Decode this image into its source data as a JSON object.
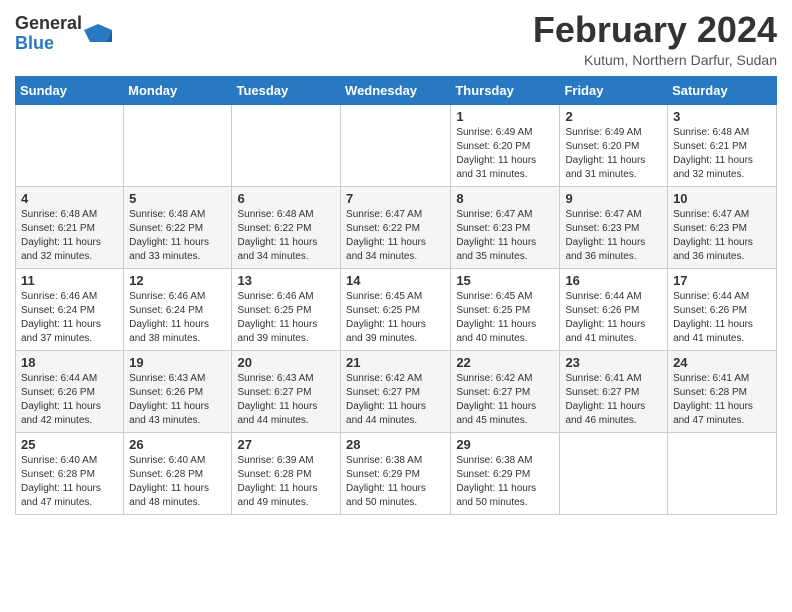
{
  "logo": {
    "general": "General",
    "blue": "Blue"
  },
  "title": "February 2024",
  "subtitle": "Kutum, Northern Darfur, Sudan",
  "days_header": [
    "Sunday",
    "Monday",
    "Tuesday",
    "Wednesday",
    "Thursday",
    "Friday",
    "Saturday"
  ],
  "weeks": [
    [
      {
        "day": "",
        "info": ""
      },
      {
        "day": "",
        "info": ""
      },
      {
        "day": "",
        "info": ""
      },
      {
        "day": "",
        "info": ""
      },
      {
        "day": "1",
        "info": "Sunrise: 6:49 AM\nSunset: 6:20 PM\nDaylight: 11 hours\nand 31 minutes."
      },
      {
        "day": "2",
        "info": "Sunrise: 6:49 AM\nSunset: 6:20 PM\nDaylight: 11 hours\nand 31 minutes."
      },
      {
        "day": "3",
        "info": "Sunrise: 6:48 AM\nSunset: 6:21 PM\nDaylight: 11 hours\nand 32 minutes."
      }
    ],
    [
      {
        "day": "4",
        "info": "Sunrise: 6:48 AM\nSunset: 6:21 PM\nDaylight: 11 hours\nand 32 minutes."
      },
      {
        "day": "5",
        "info": "Sunrise: 6:48 AM\nSunset: 6:22 PM\nDaylight: 11 hours\nand 33 minutes."
      },
      {
        "day": "6",
        "info": "Sunrise: 6:48 AM\nSunset: 6:22 PM\nDaylight: 11 hours\nand 34 minutes."
      },
      {
        "day": "7",
        "info": "Sunrise: 6:47 AM\nSunset: 6:22 PM\nDaylight: 11 hours\nand 34 minutes."
      },
      {
        "day": "8",
        "info": "Sunrise: 6:47 AM\nSunset: 6:23 PM\nDaylight: 11 hours\nand 35 minutes."
      },
      {
        "day": "9",
        "info": "Sunrise: 6:47 AM\nSunset: 6:23 PM\nDaylight: 11 hours\nand 36 minutes."
      },
      {
        "day": "10",
        "info": "Sunrise: 6:47 AM\nSunset: 6:23 PM\nDaylight: 11 hours\nand 36 minutes."
      }
    ],
    [
      {
        "day": "11",
        "info": "Sunrise: 6:46 AM\nSunset: 6:24 PM\nDaylight: 11 hours\nand 37 minutes."
      },
      {
        "day": "12",
        "info": "Sunrise: 6:46 AM\nSunset: 6:24 PM\nDaylight: 11 hours\nand 38 minutes."
      },
      {
        "day": "13",
        "info": "Sunrise: 6:46 AM\nSunset: 6:25 PM\nDaylight: 11 hours\nand 39 minutes."
      },
      {
        "day": "14",
        "info": "Sunrise: 6:45 AM\nSunset: 6:25 PM\nDaylight: 11 hours\nand 39 minutes."
      },
      {
        "day": "15",
        "info": "Sunrise: 6:45 AM\nSunset: 6:25 PM\nDaylight: 11 hours\nand 40 minutes."
      },
      {
        "day": "16",
        "info": "Sunrise: 6:44 AM\nSunset: 6:26 PM\nDaylight: 11 hours\nand 41 minutes."
      },
      {
        "day": "17",
        "info": "Sunrise: 6:44 AM\nSunset: 6:26 PM\nDaylight: 11 hours\nand 41 minutes."
      }
    ],
    [
      {
        "day": "18",
        "info": "Sunrise: 6:44 AM\nSunset: 6:26 PM\nDaylight: 11 hours\nand 42 minutes."
      },
      {
        "day": "19",
        "info": "Sunrise: 6:43 AM\nSunset: 6:26 PM\nDaylight: 11 hours\nand 43 minutes."
      },
      {
        "day": "20",
        "info": "Sunrise: 6:43 AM\nSunset: 6:27 PM\nDaylight: 11 hours\nand 44 minutes."
      },
      {
        "day": "21",
        "info": "Sunrise: 6:42 AM\nSunset: 6:27 PM\nDaylight: 11 hours\nand 44 minutes."
      },
      {
        "day": "22",
        "info": "Sunrise: 6:42 AM\nSunset: 6:27 PM\nDaylight: 11 hours\nand 45 minutes."
      },
      {
        "day": "23",
        "info": "Sunrise: 6:41 AM\nSunset: 6:27 PM\nDaylight: 11 hours\nand 46 minutes."
      },
      {
        "day": "24",
        "info": "Sunrise: 6:41 AM\nSunset: 6:28 PM\nDaylight: 11 hours\nand 47 minutes."
      }
    ],
    [
      {
        "day": "25",
        "info": "Sunrise: 6:40 AM\nSunset: 6:28 PM\nDaylight: 11 hours\nand 47 minutes."
      },
      {
        "day": "26",
        "info": "Sunrise: 6:40 AM\nSunset: 6:28 PM\nDaylight: 11 hours\nand 48 minutes."
      },
      {
        "day": "27",
        "info": "Sunrise: 6:39 AM\nSunset: 6:28 PM\nDaylight: 11 hours\nand 49 minutes."
      },
      {
        "day": "28",
        "info": "Sunrise: 6:38 AM\nSunset: 6:29 PM\nDaylight: 11 hours\nand 50 minutes."
      },
      {
        "day": "29",
        "info": "Sunrise: 6:38 AM\nSunset: 6:29 PM\nDaylight: 11 hours\nand 50 minutes."
      },
      {
        "day": "",
        "info": ""
      },
      {
        "day": "",
        "info": ""
      }
    ]
  ]
}
